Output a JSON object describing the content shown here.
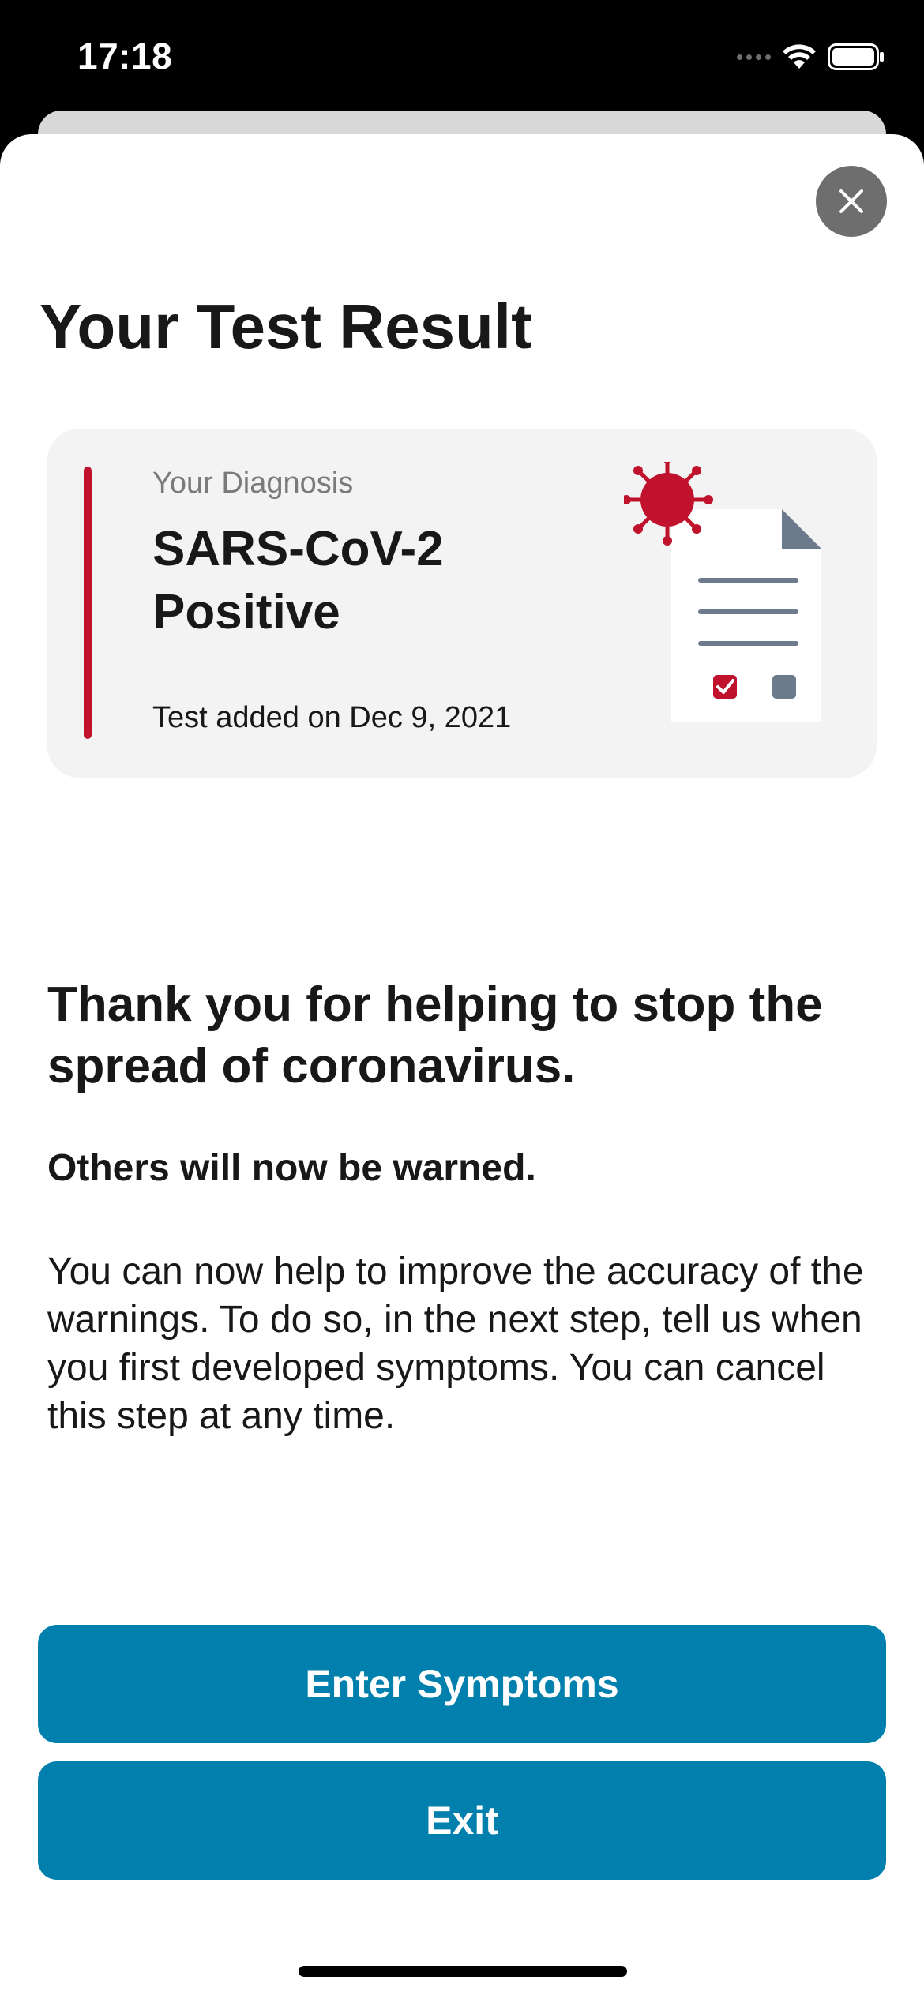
{
  "status_bar": {
    "time": "17:18",
    "icons": [
      "cellular-icon",
      "wifi-icon",
      "battery-icon"
    ]
  },
  "sheet": {
    "close_icon": "close-icon",
    "title": "Your Test Result"
  },
  "result_card": {
    "caption": "Your Diagnosis",
    "diagnosis": "SARS-CoV-2 Positive",
    "date_text": "Test added on Dec 9, 2021",
    "illustration": "virus-document-icon",
    "accent_color": "#c0122d"
  },
  "content": {
    "headline": "Thank you for helping to stop the spread of coronavirus.",
    "subhead": "Others will now be warned.",
    "body": "You can now help to improve the accuracy of the warnings. To do so, in the next step, tell us when you first developed symptoms. You can cancel this step at any time."
  },
  "actions": {
    "primary_label": "Enter Symptoms",
    "secondary_label": "Exit",
    "button_color": "#0180ad"
  }
}
